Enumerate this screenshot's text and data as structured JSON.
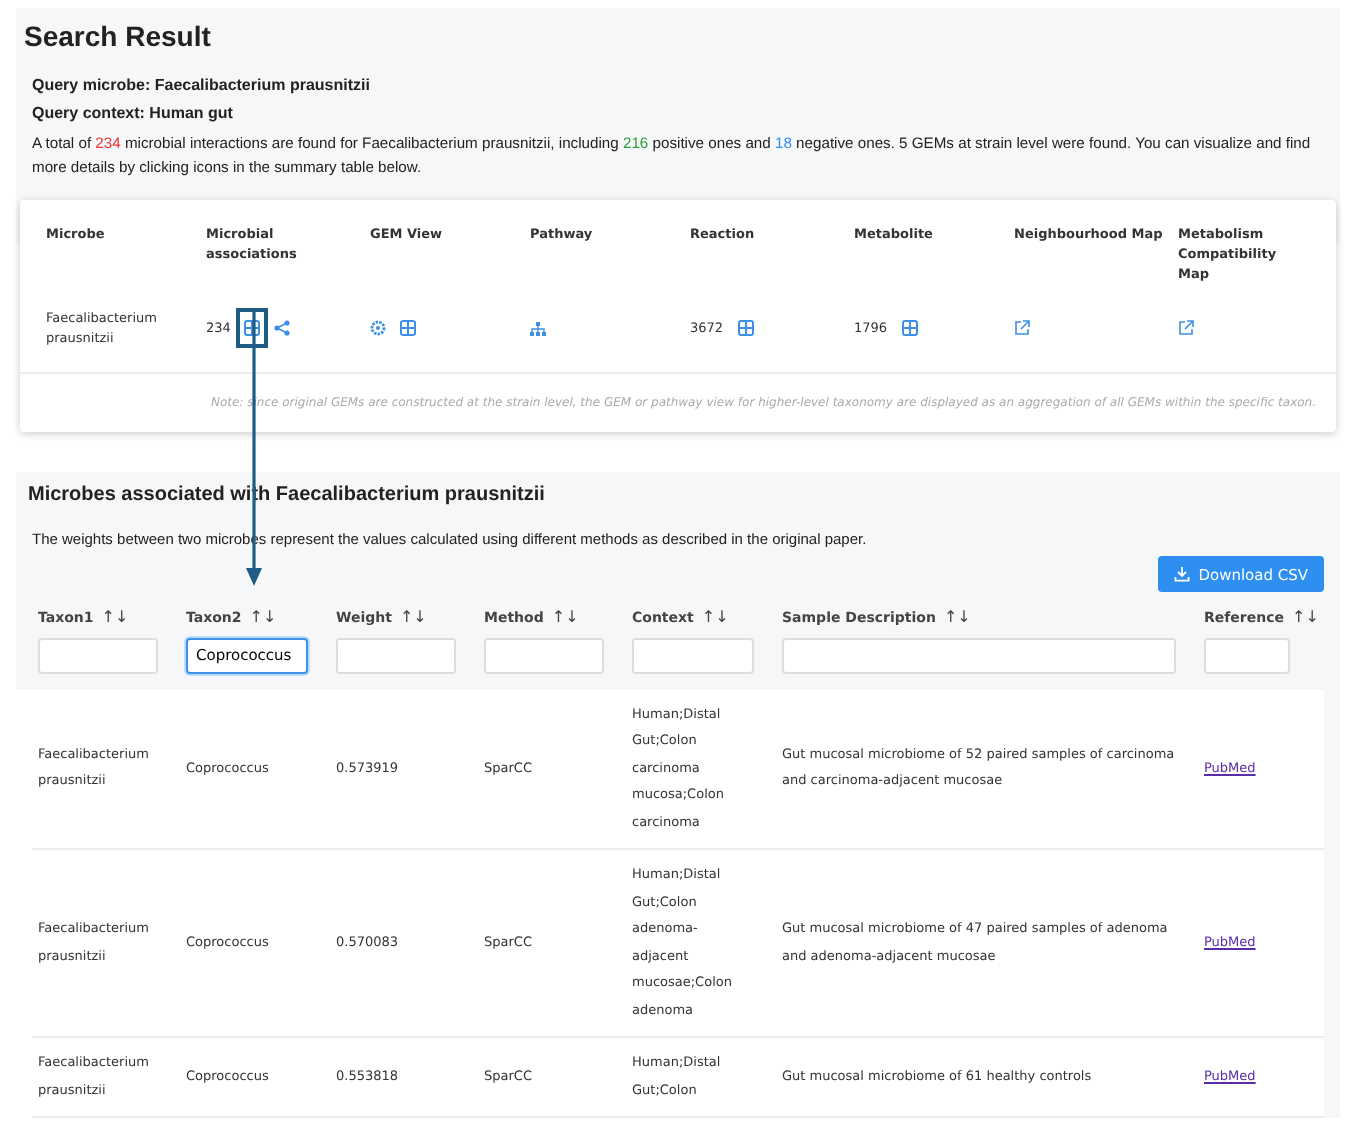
{
  "search_result": {
    "title": "Search Result",
    "query_lines": [
      "Query microbe: Faecalibacterium prausnitzii",
      "Query context: Human gut"
    ],
    "summary": [
      {
        "text": "A total of "
      },
      {
        "text": "234",
        "color": "#e53935"
      },
      {
        "text": " microbial interactions are found for Faecalibacterium prausnitzii, including "
      },
      {
        "text": "216",
        "color": "#2e9d3a"
      },
      {
        "text": " positive ones and "
      },
      {
        "text": "18",
        "color": "#2f8ff0"
      },
      {
        "text": " negative ones. 5 GEMs at strain level were found. You can visualize and find more details by clicking icons in the summary table below."
      }
    ],
    "columns": [
      "Microbe",
      "Microbial associations",
      "GEM View",
      "Pathway",
      "Reaction",
      "Metabolite",
      "Neighbourhood Map",
      "Metabolism Compatibility Map"
    ],
    "cells": [
      {
        "kind": "name",
        "text": "Faecalibacterium prausnitzii"
      },
      {
        "kind": "count_table_share",
        "text": "234",
        "highlighted": true
      },
      {
        "kind": "gear_table"
      },
      {
        "kind": "tree"
      },
      {
        "kind": "count_table",
        "text": "3672"
      },
      {
        "kind": "count_table",
        "text": "1796"
      },
      {
        "kind": "link"
      },
      {
        "kind": "link"
      }
    ],
    "note": "Note: since original GEMs are constructed at the strain level, the GEM or pathway view for higher-level taxonomy are displayed as an aggregation of all GEMs within the specific taxon."
  },
  "associations": {
    "title": "Microbes associated with Faecalibacterium prausnitzii",
    "description": "The weights between two microbes represent the values calculated using different methods as described in the original paper.",
    "download_button": "Download CSV",
    "columns": [
      {
        "label": "Taxon1",
        "sort": "↑↓",
        "focused": false
      },
      {
        "label": "Taxon2",
        "sort": "↑↓",
        "focused": true,
        "value": "Coprococcus"
      },
      {
        "label": "Weight",
        "sort": "↑↓",
        "focused": false
      },
      {
        "label": "Method",
        "sort": "↑↓",
        "focused": false
      },
      {
        "label": "Context",
        "sort": "↑↓",
        "focused": false
      },
      {
        "label": "Sample Description",
        "sort": "↑↓",
        "focused": false
      },
      {
        "label": "Reference",
        "sort": "↑↓",
        "focused": false
      }
    ],
    "rows": [
      {
        "taxon1": "Faecalibacterium prausnitzii",
        "taxon2": "Coprococcus",
        "weight": "0.573919",
        "method": "SparCC",
        "context": "Human;Distal Gut;Colon carcinoma mucosa;Colon carcinoma",
        "description": "Gut mucosal microbiome of 52 paired samples of carcinoma and carcinoma-adjacent mucosae",
        "reference": "PubMed"
      },
      {
        "taxon1": "Faecalibacterium prausnitzii",
        "taxon2": "Coprococcus",
        "weight": "0.570083",
        "method": "SparCC",
        "context": "Human;Distal Gut;Colon adenoma-adjacent mucosae;Colon adenoma",
        "description": "Gut mucosal microbiome of 47 paired samples of adenoma and adenoma-adjacent mucosae",
        "reference": "PubMed"
      },
      {
        "taxon1": "Faecalibacterium prausnitzii",
        "taxon2": "Coprococcus",
        "weight": "0.553818",
        "method": "SparCC",
        "context": "Human;Distal Gut;Colon",
        "description": "Gut mucosal microbiome of 61 healthy controls",
        "reference": "PubMed"
      }
    ]
  }
}
